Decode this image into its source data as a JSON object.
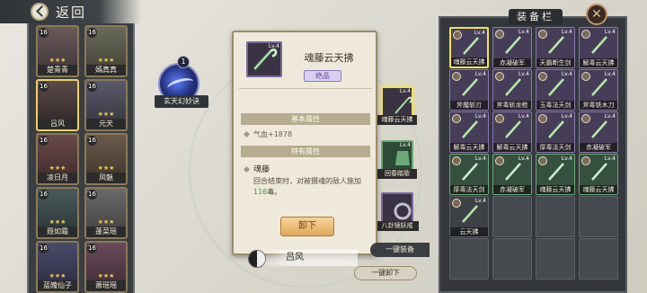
{
  "header": {
    "back_label": "返回"
  },
  "roster": [
    {
      "name": "楚青青",
      "level": "16",
      "stars": "★★★"
    },
    {
      "name": "嫣真真",
      "level": "16",
      "stars": "★★★"
    },
    {
      "name": "吕风",
      "level": "16",
      "stars": "★★★"
    },
    {
      "name": "元天",
      "level": "16",
      "stars": "★★★"
    },
    {
      "name": "凌日月",
      "level": "16",
      "stars": "★★★"
    },
    {
      "name": "凤魅",
      "level": "16",
      "stars": "★★★"
    },
    {
      "name": "聂如霜",
      "level": "16",
      "stars": "★★★"
    },
    {
      "name": "蓬菜瑶",
      "level": "16",
      "stars": "★★★"
    },
    {
      "name": "蓝魄仙子",
      "level": "16",
      "stars": "★★★"
    },
    {
      "name": "萧瑶瑶",
      "level": "16",
      "stars": "★★★"
    }
  ],
  "skill": {
    "level": "1",
    "name": "玄天幻妙诀"
  },
  "popup": {
    "item_name": "魂藤云天拂",
    "item_level": "Lv.4",
    "rank": "绝品",
    "basic_title": "基本属性",
    "basic_attr": "气血+1878",
    "special_title": "特有属性",
    "special_name": "魂藤",
    "special_desc_a": "回合结束时，对被摄魂的敌人施加",
    "special_desc_num": "116",
    "special_desc_b": "毒。",
    "unequip_label": "卸下"
  },
  "equipped": [
    {
      "name": "魂藤云天拂",
      "level": "Lv.4"
    },
    {
      "name": "回春踏歌",
      "level": "Lv.4"
    },
    {
      "name": "八卦镜妖戒",
      "level": ""
    }
  ],
  "hero_name": "吕风",
  "buttons": {
    "one_key_equip": "一键装备",
    "one_key_unequip": "一键卸下"
  },
  "inventory": {
    "title": "装备栏",
    "items": [
      {
        "name": "魂藤云天拂",
        "level": "Lv.4",
        "rarity": "purple"
      },
      {
        "name": "赤凝破军",
        "level": "Lv.4",
        "rarity": "purple"
      },
      {
        "name": "天霸断生剑",
        "level": "Lv.4",
        "rarity": "purple"
      },
      {
        "name": "解毒云天拂",
        "level": "Lv.4",
        "rarity": "purple"
      },
      {
        "name": "斧魔斩刃",
        "level": "Lv.4",
        "rarity": "purple"
      },
      {
        "name": "斧毒斩龙枪",
        "level": "Lv.4",
        "rarity": "purple"
      },
      {
        "name": "玉毒法天剑",
        "level": "Lv.4",
        "rarity": "purple"
      },
      {
        "name": "斧毒铁木刀",
        "level": "Lv.4",
        "rarity": "purple"
      },
      {
        "name": "解毒云天拂",
        "level": "Lv.4",
        "rarity": "purple"
      },
      {
        "name": "解毒云天拂",
        "level": "Lv.4",
        "rarity": "purple"
      },
      {
        "name": "厚毒法天剑",
        "level": "Lv.4",
        "rarity": "purple"
      },
      {
        "name": "赤凝破军",
        "level": "Lv.4",
        "rarity": "purple"
      },
      {
        "name": "厚毒法天剑",
        "level": "Lv.4",
        "rarity": "green"
      },
      {
        "name": "赤凝破军",
        "level": "Lv.4",
        "rarity": "green"
      },
      {
        "name": "魂藤云天拂",
        "level": "Lv.4",
        "rarity": "green"
      },
      {
        "name": "魂藤云天拂",
        "level": "Lv.4",
        "rarity": "green"
      },
      {
        "name": "云天拂",
        "level": "Lv.4",
        "rarity": "gray"
      },
      {
        "name": "",
        "level": "",
        "rarity": "empty"
      },
      {
        "name": "",
        "level": "",
        "rarity": "empty"
      },
      {
        "name": "",
        "level": "",
        "rarity": "empty"
      },
      {
        "name": "",
        "level": "",
        "rarity": "empty"
      },
      {
        "name": "",
        "level": "",
        "rarity": "empty"
      },
      {
        "name": "",
        "level": "",
        "rarity": "empty"
      },
      {
        "name": "",
        "level": "",
        "rarity": "empty"
      }
    ]
  },
  "colors": {
    "purple_rarity": "#463e58",
    "green_rarity": "#35503e",
    "gold_button": "#e0a85a",
    "highlight": "#3a9a3a"
  }
}
